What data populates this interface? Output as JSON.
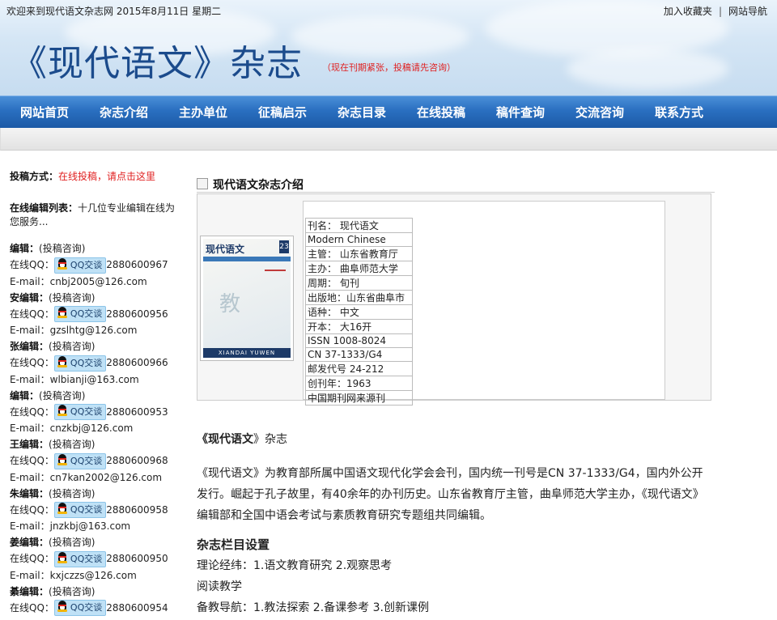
{
  "header": {
    "welcome": "欢迎来到现代语文杂志网 2015年8月11日 星期二",
    "links": [
      "加入收藏夹",
      "网站导航"
    ],
    "title": "《现代语文》杂志",
    "notice": "（现在刊期紧张，投稿请先咨询）"
  },
  "nav": [
    "网站首页",
    "杂志介绍",
    "主办单位",
    "征稿启示",
    "杂志目录",
    "在线投稿",
    "稿件查询",
    "交流咨询",
    "联系方式"
  ],
  "sidebar": {
    "submit_label": "投稿方式：",
    "submit_text": "在线投稿，请点击这里",
    "list_label": "在线编辑列表：",
    "list_text": "十几位专业编辑在线为您服务...",
    "qq_label": "在线QQ：",
    "qq_button": "QQ交谈",
    "email_label": "E-mail：",
    "consult": "(投稿咨询)",
    "editors": [
      {
        "name": "编辑：",
        "qq": "2880600967",
        "email": "cnbj2005@126.com"
      },
      {
        "name": "安编辑：",
        "qq": "2880600956",
        "email": "gzslhtg@126.com"
      },
      {
        "name": "张编辑：",
        "qq": "2880600966",
        "email": "wlbianji@163.com"
      },
      {
        "name": "编辑：",
        "qq": "2880600953",
        "email": "cnzkbj@126.com"
      },
      {
        "name": "王编辑：",
        "qq": "2880600968",
        "email": "cn7kan2002@126.com"
      },
      {
        "name": "朱编辑：",
        "qq": "2880600958",
        "email": "jnzkbj@163.com"
      },
      {
        "name": "姜编辑：",
        "qq": "2880600950",
        "email": "kxjczzs@126.com"
      },
      {
        "name": "綦编辑：",
        "qq": "2880600954",
        "email": ""
      }
    ]
  },
  "main": {
    "section_title": "现代语文杂志介绍",
    "cover": {
      "title": "现代语文",
      "issue": "23",
      "foot": "XIANDAI YUWEN",
      "mid": "教"
    },
    "info": [
      "刊名： 现代语文",
      "Modern Chinese",
      "主管： 山东省教育厅",
      "主办： 曲阜师范大学",
      "周期： 旬刊",
      "出版地：山东省曲阜市",
      "语种： 中文",
      "开本： 大16开",
      "ISSN 1008-8024",
      "CN 37-1333/G4",
      "邮发代号 24-212",
      "创刊年：1963",
      "中国期刊网来源刊"
    ],
    "article": {
      "heading_bold": "《现代语文",
      "heading_rest": "》杂志",
      "intro": "《现代语文》为教育部所属中国语文现代化学会会刊，国内统一刊号是CN 37-1333/G4，国内外公开发行。崛起于孔子故里，有40余年的办刊历史。山东省教育厅主管，曲阜师范大学主办，《现代语文》编辑部和全国中语会考试与素质教育研究专题组共同编辑。",
      "columns_title": "杂志栏目设置",
      "columns": [
        "理论经纬：1.语文教育研究 2.观察思考",
        "阅读教学",
        "备教导航：1.教法探索 2.备课参考 3.创新课例"
      ]
    }
  }
}
